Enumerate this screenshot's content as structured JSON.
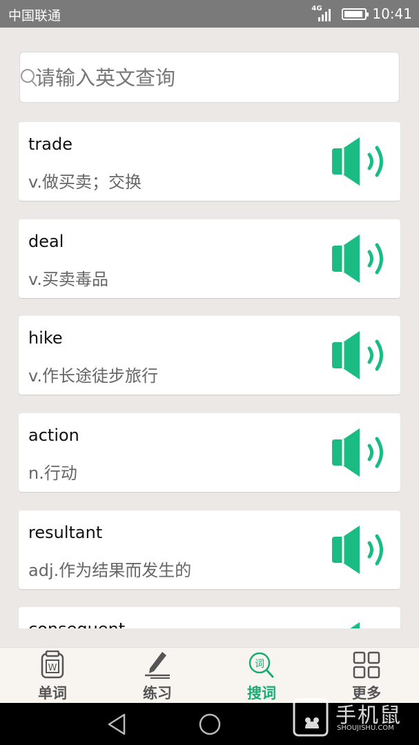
{
  "status_bar": {
    "carrier": "中国联通",
    "network": "4G",
    "time": "10:41"
  },
  "search": {
    "placeholder": "请输入英文查询"
  },
  "words": [
    {
      "word": "trade",
      "definition": "v.做买卖；交换"
    },
    {
      "word": "deal",
      "definition": "v.买卖毒品"
    },
    {
      "word": "hike",
      "definition": "v.作长途徒步旅行"
    },
    {
      "word": "action",
      "definition": "n.行动"
    },
    {
      "word": "resultant",
      "definition": "adj.作为结果而发生的"
    },
    {
      "word": "consequent",
      "definition": ""
    }
  ],
  "tabs": [
    {
      "label": "单词",
      "icon": "word-book-icon",
      "active": false
    },
    {
      "label": "练习",
      "icon": "pen-icon",
      "active": false
    },
    {
      "label": "搜词",
      "icon": "search-word-icon",
      "active": true
    },
    {
      "label": "更多",
      "icon": "grid-icon",
      "active": false
    }
  ],
  "watermark": {
    "text": "手机鼠",
    "sub": "SHOUJISHU.COM"
  },
  "colors": {
    "accent": "#1abc84",
    "active_tab": "#1aaa74",
    "status_bar": "#7a7a7a",
    "background": "#ebe8e5"
  }
}
